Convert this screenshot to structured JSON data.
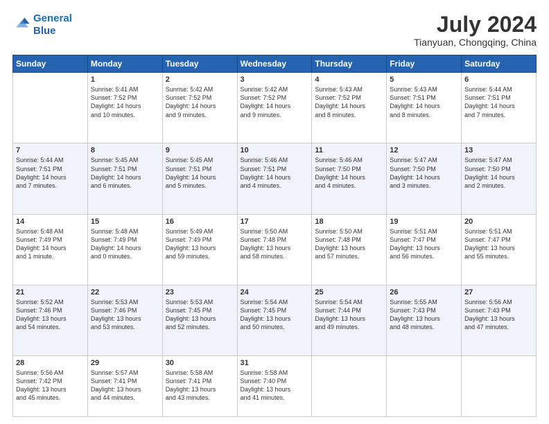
{
  "logo": {
    "line1": "General",
    "line2": "Blue"
  },
  "title": "July 2024",
  "location": "Tianyuan, Chongqing, China",
  "headers": [
    "Sunday",
    "Monday",
    "Tuesday",
    "Wednesday",
    "Thursday",
    "Friday",
    "Saturday"
  ],
  "weeks": [
    [
      {
        "day": "",
        "text": ""
      },
      {
        "day": "1",
        "text": "Sunrise: 5:41 AM\nSunset: 7:52 PM\nDaylight: 14 hours\nand 10 minutes."
      },
      {
        "day": "2",
        "text": "Sunrise: 5:42 AM\nSunset: 7:52 PM\nDaylight: 14 hours\nand 9 minutes."
      },
      {
        "day": "3",
        "text": "Sunrise: 5:42 AM\nSunset: 7:52 PM\nDaylight: 14 hours\nand 9 minutes."
      },
      {
        "day": "4",
        "text": "Sunrise: 5:43 AM\nSunset: 7:52 PM\nDaylight: 14 hours\nand 8 minutes."
      },
      {
        "day": "5",
        "text": "Sunrise: 5:43 AM\nSunset: 7:51 PM\nDaylight: 14 hours\nand 8 minutes."
      },
      {
        "day": "6",
        "text": "Sunrise: 5:44 AM\nSunset: 7:51 PM\nDaylight: 14 hours\nand 7 minutes."
      }
    ],
    [
      {
        "day": "7",
        "text": "Sunrise: 5:44 AM\nSunset: 7:51 PM\nDaylight: 14 hours\nand 7 minutes."
      },
      {
        "day": "8",
        "text": "Sunrise: 5:45 AM\nSunset: 7:51 PM\nDaylight: 14 hours\nand 6 minutes."
      },
      {
        "day": "9",
        "text": "Sunrise: 5:45 AM\nSunset: 7:51 PM\nDaylight: 14 hours\nand 5 minutes."
      },
      {
        "day": "10",
        "text": "Sunrise: 5:46 AM\nSunset: 7:51 PM\nDaylight: 14 hours\nand 4 minutes."
      },
      {
        "day": "11",
        "text": "Sunrise: 5:46 AM\nSunset: 7:50 PM\nDaylight: 14 hours\nand 4 minutes."
      },
      {
        "day": "12",
        "text": "Sunrise: 5:47 AM\nSunset: 7:50 PM\nDaylight: 14 hours\nand 3 minutes."
      },
      {
        "day": "13",
        "text": "Sunrise: 5:47 AM\nSunset: 7:50 PM\nDaylight: 14 hours\nand 2 minutes."
      }
    ],
    [
      {
        "day": "14",
        "text": "Sunrise: 5:48 AM\nSunset: 7:49 PM\nDaylight: 14 hours\nand 1 minute."
      },
      {
        "day": "15",
        "text": "Sunrise: 5:48 AM\nSunset: 7:49 PM\nDaylight: 14 hours\nand 0 minutes."
      },
      {
        "day": "16",
        "text": "Sunrise: 5:49 AM\nSunset: 7:49 PM\nDaylight: 13 hours\nand 59 minutes."
      },
      {
        "day": "17",
        "text": "Sunrise: 5:50 AM\nSunset: 7:48 PM\nDaylight: 13 hours\nand 58 minutes."
      },
      {
        "day": "18",
        "text": "Sunrise: 5:50 AM\nSunset: 7:48 PM\nDaylight: 13 hours\nand 57 minutes."
      },
      {
        "day": "19",
        "text": "Sunrise: 5:51 AM\nSunset: 7:47 PM\nDaylight: 13 hours\nand 56 minutes."
      },
      {
        "day": "20",
        "text": "Sunrise: 5:51 AM\nSunset: 7:47 PM\nDaylight: 13 hours\nand 55 minutes."
      }
    ],
    [
      {
        "day": "21",
        "text": "Sunrise: 5:52 AM\nSunset: 7:46 PM\nDaylight: 13 hours\nand 54 minutes."
      },
      {
        "day": "22",
        "text": "Sunrise: 5:53 AM\nSunset: 7:46 PM\nDaylight: 13 hours\nand 53 minutes."
      },
      {
        "day": "23",
        "text": "Sunrise: 5:53 AM\nSunset: 7:45 PM\nDaylight: 13 hours\nand 52 minutes."
      },
      {
        "day": "24",
        "text": "Sunrise: 5:54 AM\nSunset: 7:45 PM\nDaylight: 13 hours\nand 50 minutes."
      },
      {
        "day": "25",
        "text": "Sunrise: 5:54 AM\nSunset: 7:44 PM\nDaylight: 13 hours\nand 49 minutes."
      },
      {
        "day": "26",
        "text": "Sunrise: 5:55 AM\nSunset: 7:43 PM\nDaylight: 13 hours\nand 48 minutes."
      },
      {
        "day": "27",
        "text": "Sunrise: 5:56 AM\nSunset: 7:43 PM\nDaylight: 13 hours\nand 47 minutes."
      }
    ],
    [
      {
        "day": "28",
        "text": "Sunrise: 5:56 AM\nSunset: 7:42 PM\nDaylight: 13 hours\nand 45 minutes."
      },
      {
        "day": "29",
        "text": "Sunrise: 5:57 AM\nSunset: 7:41 PM\nDaylight: 13 hours\nand 44 minutes."
      },
      {
        "day": "30",
        "text": "Sunrise: 5:58 AM\nSunset: 7:41 PM\nDaylight: 13 hours\nand 43 minutes."
      },
      {
        "day": "31",
        "text": "Sunrise: 5:58 AM\nSunset: 7:40 PM\nDaylight: 13 hours\nand 41 minutes."
      },
      {
        "day": "",
        "text": ""
      },
      {
        "day": "",
        "text": ""
      },
      {
        "day": "",
        "text": ""
      }
    ]
  ]
}
